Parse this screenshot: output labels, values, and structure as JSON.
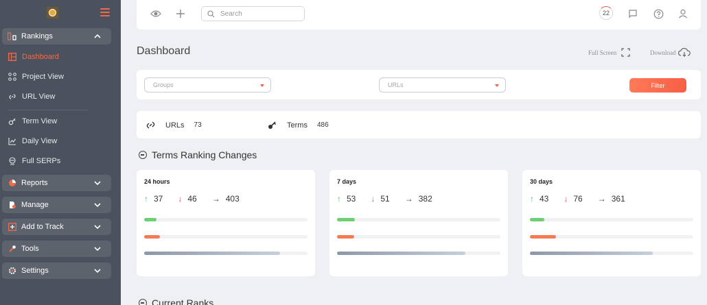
{
  "sidebar": {
    "groups": [
      {
        "label": "Rankings",
        "icon": "bar-chart-icon",
        "expanded": true
      },
      {
        "label": "Reports",
        "icon": "pie-chart-icon",
        "expanded": false
      },
      {
        "label": "Manage",
        "icon": "file-gear-icon",
        "expanded": false
      },
      {
        "label": "Add to Track",
        "icon": "plus-square-icon",
        "expanded": false
      },
      {
        "label": "Tools",
        "icon": "wrench-icon",
        "expanded": false
      },
      {
        "label": "Settings",
        "icon": "gear-icon",
        "expanded": false
      }
    ],
    "items": [
      {
        "label": "Dashboard",
        "icon": "dashboard-icon",
        "active": true
      },
      {
        "label": "Project View",
        "icon": "project-icon"
      },
      {
        "label": "URL View",
        "icon": "link-icon"
      },
      {
        "label": "Term View",
        "icon": "key-icon"
      },
      {
        "label": "Daily View",
        "icon": "line-chart-icon"
      },
      {
        "label": "Full SERPs",
        "icon": "serp-icon"
      }
    ]
  },
  "topbar": {
    "search_placeholder": "Search",
    "notification_count": "22"
  },
  "page": {
    "title": "Dashboard",
    "full_screen": "Full Screen",
    "download": "Download"
  },
  "filters": {
    "groups_placeholder": "Groups",
    "urls_placeholder": "URLs",
    "filter_label": "Filter"
  },
  "stats": {
    "urls_label": "URLs",
    "urls_value": "73",
    "terms_label": "Terms",
    "terms_value": "486"
  },
  "sections": {
    "terms_changes": "Terms Ranking Changes",
    "current_ranks": "Current Ranks"
  },
  "cards": [
    {
      "title": "24 hours",
      "up": "37",
      "down": "46",
      "same": "403",
      "up_fraction": 0.077,
      "down_fraction": 0.095,
      "same_fraction": 0.83
    },
    {
      "title": "7 days",
      "up": "53",
      "down": "51",
      "same": "382",
      "up_fraction": 0.109,
      "down_fraction": 0.105,
      "same_fraction": 0.786
    },
    {
      "title": "30 days",
      "up": "43",
      "down": "76",
      "same": "361",
      "up_fraction": 0.09,
      "down_fraction": 0.158,
      "same_fraction": 0.752
    }
  ],
  "colors": {
    "accent": "#f26a4b",
    "sidebar_bg": "#4b525d",
    "up": "#4cbf6b",
    "down": "#e8544a"
  }
}
